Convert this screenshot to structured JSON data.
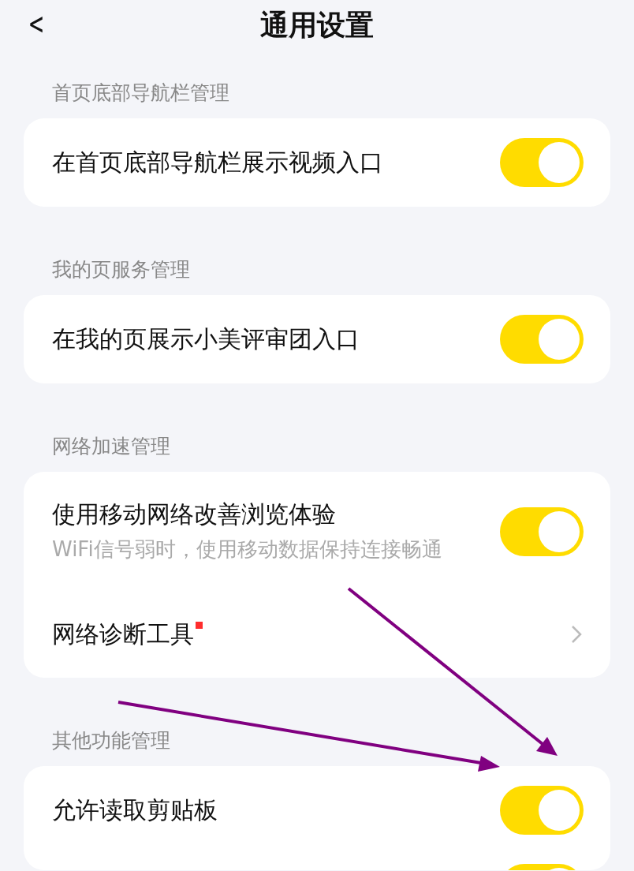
{
  "header": {
    "back": "<",
    "title": "通用设置"
  },
  "sections": [
    {
      "title": "首页底部导航栏管理",
      "items": [
        {
          "kind": "toggle",
          "label": "在首页底部导航栏展示视频入口",
          "on": true
        }
      ]
    },
    {
      "title": "我的页服务管理",
      "items": [
        {
          "kind": "toggle",
          "label": "在我的页展示小美评审团入口",
          "on": true
        }
      ]
    },
    {
      "title": "网络加速管理",
      "items": [
        {
          "kind": "toggle",
          "label": "使用移动网络改善浏览体验",
          "subtitle": "WiFi信号弱时，使用移动数据保持连接畅通",
          "on": true
        },
        {
          "kind": "link",
          "label": "网络诊断工具",
          "dot": true
        }
      ]
    },
    {
      "title": "其他功能管理",
      "items": [
        {
          "kind": "toggle",
          "label": "允许读取剪贴板",
          "on": true
        },
        {
          "kind": "toggle",
          "on": true
        }
      ]
    }
  ]
}
